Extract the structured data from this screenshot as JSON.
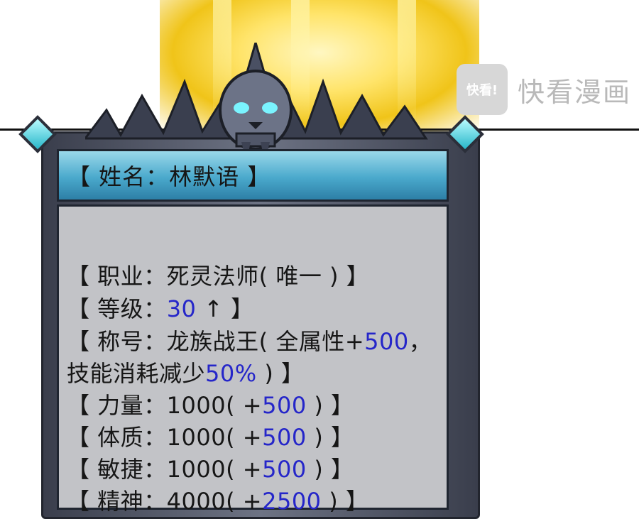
{
  "watermark": {
    "logo_text": "快看!",
    "brand": "快看漫画"
  },
  "card": {
    "name_label": "【 姓名：林默语 】",
    "lines": [
      {
        "black1": "【 职业：死灵法师( 唯一 ) 】",
        "blue": "",
        "black2": ""
      },
      {
        "black1": "【 等级：",
        "blue": "30",
        "black2": " ↑ 】"
      },
      {
        "black1": "【 称号：龙族战王( 全属性+",
        "blue": "500",
        "black2": "，"
      },
      {
        "black1": " 技能消耗减少",
        "blue": "50%",
        "black2": " ) 】"
      },
      {
        "black1": "【 力量：1000( +",
        "blue": "500",
        "black2": " ) 】"
      },
      {
        "black1": "【 体质：1000( +",
        "blue": "500",
        "black2": " ) 】"
      },
      {
        "black1": "【 敏捷：1000( +",
        "blue": "500",
        "black2": " ) 】"
      },
      {
        "black1": "【 精神：4000( +",
        "blue": "2500",
        "black2": " ) 】"
      }
    ]
  },
  "colors": {
    "highlight": "#2526c9",
    "header_bg": "#4aa9cc",
    "panel_bg": "#c2c3c7",
    "glow": "#f0c419"
  }
}
